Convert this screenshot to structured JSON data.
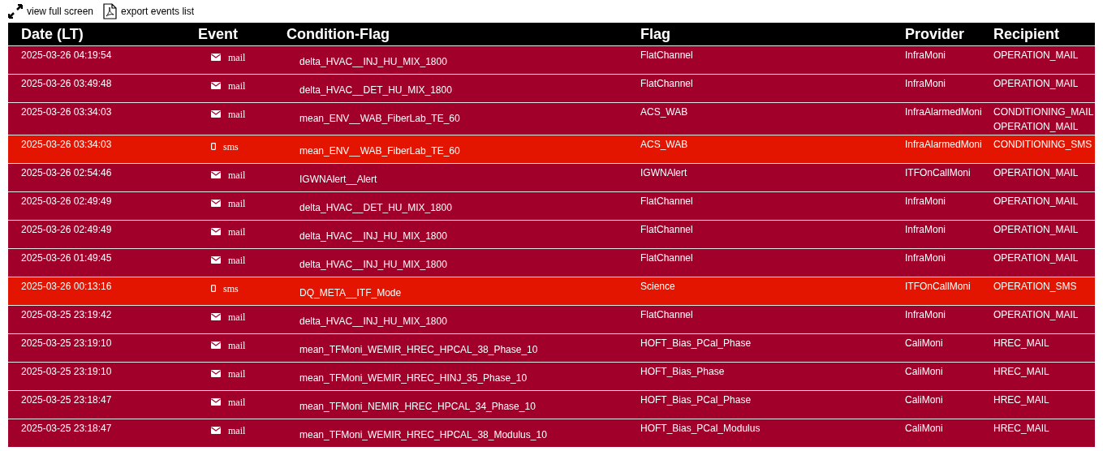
{
  "toolbar": [
    {
      "kind": "fullscreen",
      "label": "view full screen"
    },
    {
      "kind": "export",
      "label": "export events list"
    }
  ],
  "table": {
    "columns": [
      "Date (LT)",
      "Event",
      "Condition-Flag",
      "Flag",
      "Provider",
      "Recipient"
    ],
    "rows": [
      {
        "date": "2025-03-26 04:19:54",
        "event": {
          "kind": "mail",
          "label": "mail"
        },
        "condition": "delta_HVAC__INJ_HU_MIX_1800",
        "flag": "FlatChannel",
        "provider": "InfraMoni",
        "recipients": [
          "OPERATION_MAIL"
        ]
      },
      {
        "date": "2025-03-26 03:49:48",
        "event": {
          "kind": "mail",
          "label": "mail"
        },
        "condition": "delta_HVAC__DET_HU_MIX_1800",
        "flag": "FlatChannel",
        "provider": "InfraMoni",
        "recipients": [
          "OPERATION_MAIL"
        ]
      },
      {
        "date": "2025-03-26 03:34:03",
        "event": {
          "kind": "mail",
          "label": "mail"
        },
        "condition": "mean_ENV__WAB_FiberLab_TE_60",
        "flag": "ACS_WAB",
        "provider": "InfraAlarmedMoni",
        "recipients": [
          "CONDITIONING_MAIL",
          "OPERATION_MAIL"
        ]
      },
      {
        "date": "2025-03-26 03:34:03",
        "event": {
          "kind": "sms",
          "label": "sms"
        },
        "condition": "mean_ENV__WAB_FiberLab_TE_60",
        "flag": "ACS_WAB",
        "provider": "InfraAlarmedMoni",
        "recipients": [
          "CONDITIONING_SMS"
        ]
      },
      {
        "date": "2025-03-26 02:54:46",
        "event": {
          "kind": "mail",
          "label": "mail"
        },
        "condition": "IGWNAlert__Alert",
        "flag": "IGWNAlert",
        "provider": "ITFOnCallMoni",
        "recipients": [
          "OPERATION_MAIL"
        ]
      },
      {
        "date": "2025-03-26 02:49:49",
        "event": {
          "kind": "mail",
          "label": "mail"
        },
        "condition": "delta_HVAC__DET_HU_MIX_1800",
        "flag": "FlatChannel",
        "provider": "InfraMoni",
        "recipients": [
          "OPERATION_MAIL"
        ]
      },
      {
        "date": "2025-03-26 02:49:49",
        "event": {
          "kind": "mail",
          "label": "mail"
        },
        "condition": "delta_HVAC__INJ_HU_MIX_1800",
        "flag": "FlatChannel",
        "provider": "InfraMoni",
        "recipients": [
          "OPERATION_MAIL"
        ]
      },
      {
        "date": "2025-03-26 01:49:45",
        "event": {
          "kind": "mail",
          "label": "mail"
        },
        "condition": "delta_HVAC__INJ_HU_MIX_1800",
        "flag": "FlatChannel",
        "provider": "InfraMoni",
        "recipients": [
          "OPERATION_MAIL"
        ]
      },
      {
        "date": "2025-03-26 00:13:16",
        "event": {
          "kind": "sms",
          "label": "sms"
        },
        "condition": "DQ_META__ITF_Mode",
        "flag": "Science",
        "provider": "ITFOnCallMoni",
        "recipients": [
          "OPERATION_SMS"
        ]
      },
      {
        "date": "2025-03-25 23:19:42",
        "event": {
          "kind": "mail",
          "label": "mail"
        },
        "condition": "delta_HVAC__INJ_HU_MIX_1800",
        "flag": "FlatChannel",
        "provider": "InfraMoni",
        "recipients": [
          "OPERATION_MAIL"
        ]
      },
      {
        "date": "2025-03-25 23:19:10",
        "event": {
          "kind": "mail",
          "label": "mail"
        },
        "condition": "mean_TFMoni_WEMIR_HREC_HPCAL_38_Phase_10",
        "flag": "HOFT_Bias_PCal_Phase",
        "provider": "CaliMoni",
        "recipients": [
          "HREC_MAIL"
        ]
      },
      {
        "date": "2025-03-25 23:19:10",
        "event": {
          "kind": "mail",
          "label": "mail"
        },
        "condition": "mean_TFMoni_WEMIR_HREC_HINJ_35_Phase_10",
        "flag": "HOFT_Bias_Phase",
        "provider": "CaliMoni",
        "recipients": [
          "HREC_MAIL"
        ]
      },
      {
        "date": "2025-03-25 23:18:47",
        "event": {
          "kind": "mail",
          "label": "mail"
        },
        "condition": "mean_TFMoni_NEMIR_HREC_HPCAL_34_Phase_10",
        "flag": "HOFT_Bias_PCal_Phase",
        "provider": "CaliMoni",
        "recipients": [
          "HREC_MAIL"
        ]
      },
      {
        "date": "2025-03-25 23:18:47",
        "event": {
          "kind": "mail",
          "label": "mail"
        },
        "condition": "mean_TFMoni_WEMIR_HREC_HPCAL_38_Modulus_10",
        "flag": "HOFT_Bias_PCal_Modulus",
        "provider": "CaliMoni",
        "recipients": [
          "HREC_MAIL"
        ]
      }
    ]
  }
}
